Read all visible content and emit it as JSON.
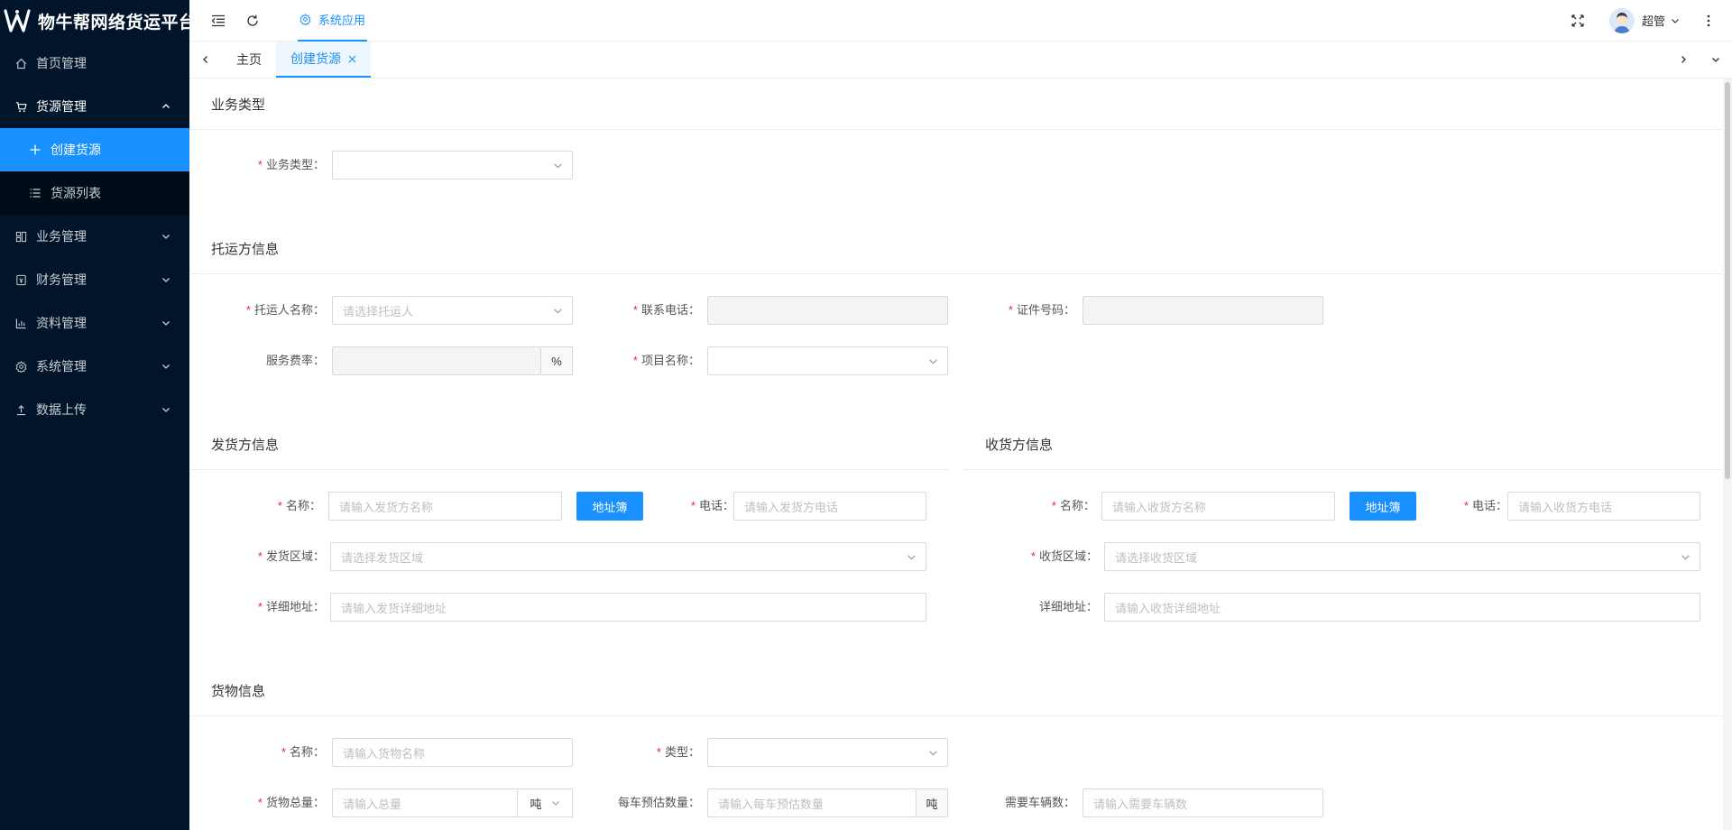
{
  "app": {
    "title": "物牛帮网络货运平台"
  },
  "sidebar": {
    "items": [
      {
        "label": "首页管理",
        "icon": "home-icon"
      },
      {
        "label": "货源管理",
        "icon": "cart-icon",
        "open": true,
        "children": [
          {
            "label": "创建货源",
            "icon": "plus-icon",
            "active": true
          },
          {
            "label": "货源列表",
            "icon": "list-icon"
          }
        ]
      },
      {
        "label": "业务管理",
        "icon": "layout-icon"
      },
      {
        "label": "财务管理",
        "icon": "account-book-icon"
      },
      {
        "label": "资料管理",
        "icon": "bar-chart-icon"
      },
      {
        "label": "系统管理",
        "icon": "setting-icon"
      },
      {
        "label": "数据上传",
        "icon": "upload-icon"
      }
    ]
  },
  "header": {
    "nav_label": "系统应用",
    "user_name": "超管"
  },
  "tabs": [
    {
      "label": "主页"
    },
    {
      "label": "创建货源",
      "active": true
    }
  ],
  "form": {
    "business": {
      "title": "业务类型",
      "type_label": "业务类型"
    },
    "shipper": {
      "title": "托运方信息",
      "name_label": "托运人名称",
      "name_placeholder": "请选择托运人",
      "phone_label": "联系电话",
      "id_label": "证件号码",
      "fee_label": "服务费率",
      "fee_unit": "%",
      "project_label": "项目名称"
    },
    "sender": {
      "title": "发货方信息",
      "name_label": "名称",
      "name_placeholder": "请输入发货方名称",
      "address_book": "地址簿",
      "phone_label": "电话",
      "phone_placeholder": "请输入发货方电话",
      "region_label": "发货区域",
      "region_placeholder": "请选择发货区域",
      "address_label": "详细地址",
      "address_placeholder": "请输入发货详细地址"
    },
    "receiver": {
      "title": "收货方信息",
      "name_label": "名称",
      "name_placeholder": "请输入收货方名称",
      "address_book": "地址簿",
      "phone_label": "电话",
      "phone_placeholder": "请输入收货方电话",
      "region_label": "收货区域",
      "region_placeholder": "请选择收货区域",
      "address_label": "详细地址",
      "address_placeholder": "请输入收货详细地址"
    },
    "goods": {
      "title": "货物信息",
      "name_label": "名称",
      "name_placeholder": "请输入货物名称",
      "type_label": "类型",
      "total_label": "货物总量",
      "total_placeholder": "请输入总量",
      "total_unit": "吨",
      "per_vehicle_label": "每车预估数量",
      "per_vehicle_placeholder": "请输入每车预估数量",
      "per_vehicle_unit": "吨",
      "vehicles_label": "需要车辆数",
      "vehicles_placeholder": "请输入需要车辆数"
    }
  },
  "colors": {
    "sidebar_bg": "#001529",
    "accent": "#1890ff",
    "required": "#f5222d"
  }
}
